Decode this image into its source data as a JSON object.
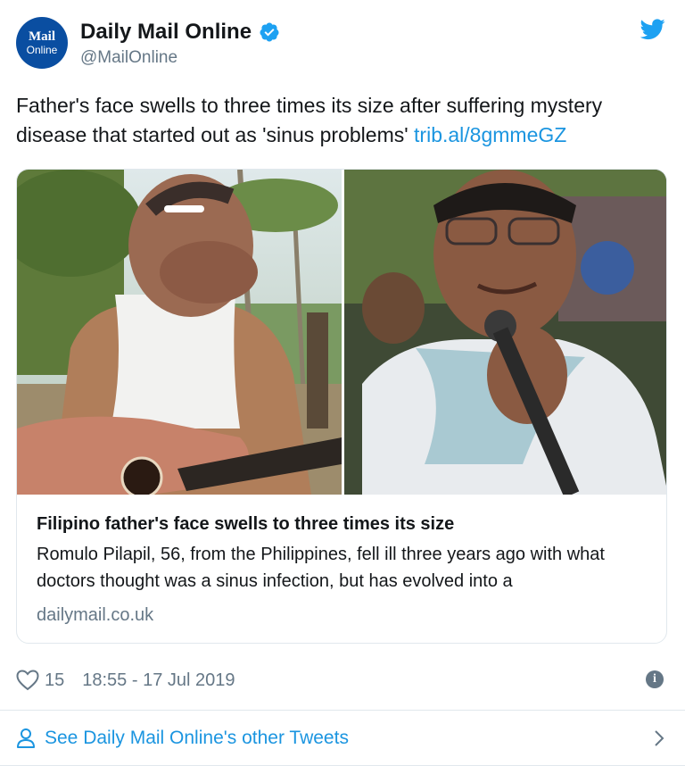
{
  "account": {
    "display_name": "Daily Mail Online",
    "handle": "@MailOnline",
    "avatar_line1": "Mail",
    "avatar_line2": "Online"
  },
  "tweet": {
    "text": "Father's face swells to three times its size after suffering mystery disease that started out as 'sinus problems' ",
    "link": "trib.al/8gmmeGZ"
  },
  "card": {
    "title": "Filipino father's face swells to three times its size",
    "description": "Romulo Pilapil, 56, from the Philippines, fell ill three years ago with what doctors thought was a sinus infection, but has evolved into a",
    "domain": "dailymail.co.uk"
  },
  "meta": {
    "likes": "15",
    "timestamp": "18:55 - 17 Jul 2019"
  },
  "footer": {
    "link_text": "See Daily Mail Online's other Tweets"
  },
  "colors": {
    "twitter_blue": "#1b95e0",
    "daily_mail_blue": "#0a4ea1",
    "gray": "#657786"
  },
  "icons": [
    "verified-badge-icon",
    "twitter-bird-icon",
    "heart-icon",
    "info-icon",
    "person-icon",
    "chevron-right-icon"
  ]
}
